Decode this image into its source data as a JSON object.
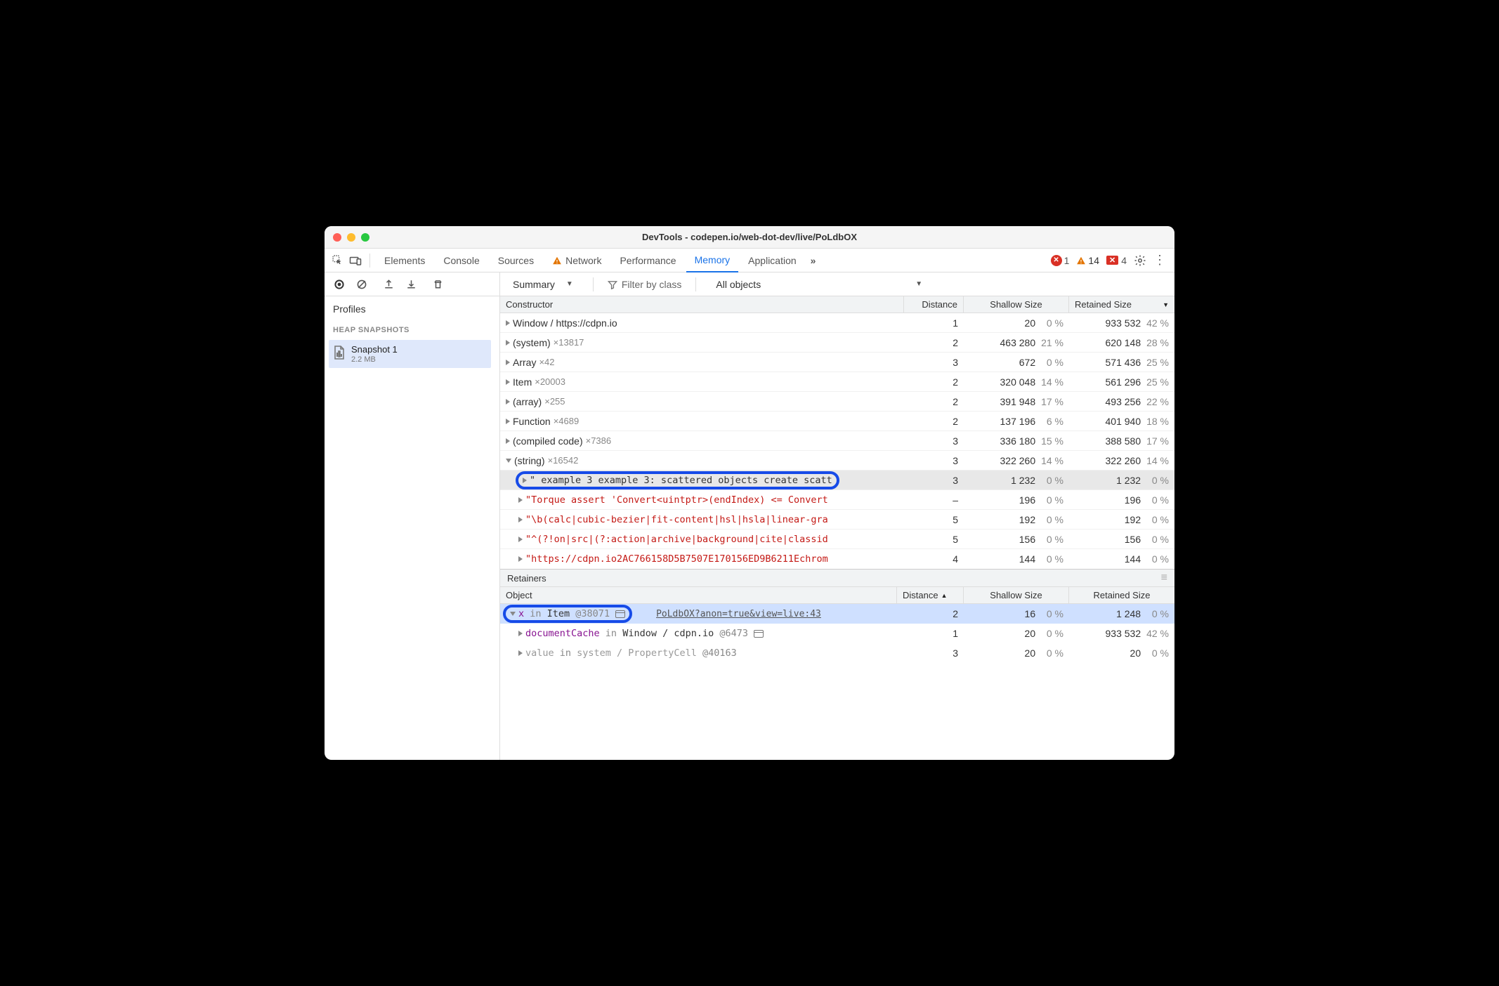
{
  "window_title": "DevTools - codepen.io/web-dot-dev/live/PoLdbOX",
  "tabs": {
    "elements": "Elements",
    "console": "Console",
    "sources": "Sources",
    "network": "Network",
    "performance": "Performance",
    "memory": "Memory",
    "application": "Application"
  },
  "status": {
    "errors": "1",
    "warnings": "14",
    "issues": "4"
  },
  "toolbar": {
    "summary": "Summary",
    "filter_placeholder": "Filter by class",
    "all_objects": "All objects"
  },
  "profiles": {
    "title": "Profiles",
    "section": "HEAP SNAPSHOTS",
    "snapshot_name": "Snapshot 1",
    "snapshot_size": "2.2 MB"
  },
  "columns": {
    "constructor": "Constructor",
    "distance": "Distance",
    "shallow": "Shallow Size",
    "retained": "Retained Size"
  },
  "rows": [
    {
      "name": "Window / https://cdpn.io",
      "count": "",
      "dist": "1",
      "ssize": "20",
      "spct": "0 %",
      "rsize": "933 532",
      "rpct": "42 %",
      "indent": 0
    },
    {
      "name": "(system)",
      "count": "×13817",
      "dist": "2",
      "ssize": "463 280",
      "spct": "21 %",
      "rsize": "620 148",
      "rpct": "28 %",
      "indent": 0
    },
    {
      "name": "Array",
      "count": "×42",
      "dist": "3",
      "ssize": "672",
      "spct": "0 %",
      "rsize": "571 436",
      "rpct": "25 %",
      "indent": 0
    },
    {
      "name": "Item",
      "count": "×20003",
      "dist": "2",
      "ssize": "320 048",
      "spct": "14 %",
      "rsize": "561 296",
      "rpct": "25 %",
      "indent": 0
    },
    {
      "name": "(array)",
      "count": "×255",
      "dist": "2",
      "ssize": "391 948",
      "spct": "17 %",
      "rsize": "493 256",
      "rpct": "22 %",
      "indent": 0
    },
    {
      "name": "Function",
      "count": "×4689",
      "dist": "2",
      "ssize": "137 196",
      "spct": "6 %",
      "rsize": "401 940",
      "rpct": "18 %",
      "indent": 0
    },
    {
      "name": "(compiled code)",
      "count": "×7386",
      "dist": "3",
      "ssize": "336 180",
      "spct": "15 %",
      "rsize": "388 580",
      "rpct": "17 %",
      "indent": 0
    },
    {
      "name": "(string)",
      "count": "×16542",
      "dist": "3",
      "ssize": "322 260",
      "spct": "14 %",
      "rsize": "322 260",
      "rpct": "14 %",
      "indent": 0,
      "open": true
    },
    {
      "name": "\"  example 3 example 3: scattered objects create scatt",
      "count": "",
      "dist": "3",
      "ssize": "1 232",
      "spct": "0 %",
      "rsize": "1 232",
      "rpct": "0 %",
      "indent": 1,
      "mono": true,
      "sel": true,
      "ring": true
    },
    {
      "name": "\"Torque assert 'Convert<uintptr>(endIndex) <= Convert",
      "count": "",
      "dist": "–",
      "ssize": "196",
      "spct": "0 %",
      "rsize": "196",
      "rpct": "0 %",
      "indent": 1,
      "mono": true,
      "str": true
    },
    {
      "name": "\"\\b(calc|cubic-bezier|fit-content|hsl|hsla|linear-gra",
      "count": "",
      "dist": "5",
      "ssize": "192",
      "spct": "0 %",
      "rsize": "192",
      "rpct": "0 %",
      "indent": 1,
      "mono": true,
      "str": true
    },
    {
      "name": "\"^(?!on|src|(?:action|archive|background|cite|classid",
      "count": "",
      "dist": "5",
      "ssize": "156",
      "spct": "0 %",
      "rsize": "156",
      "rpct": "0 %",
      "indent": 1,
      "mono": true,
      "str": true
    },
    {
      "name": "\"https://cdpn.io2AC766158D5B7507E170156ED9B6211Echrom",
      "count": "",
      "dist": "4",
      "ssize": "144",
      "spct": "0 %",
      "rsize": "144",
      "rpct": "0 %",
      "indent": 1,
      "mono": true,
      "str": true
    }
  ],
  "retainers": {
    "title": "Retainers",
    "cols": {
      "object": "Object",
      "distance": "Distance",
      "shallow": "Shallow Size",
      "retained": "Retained Size"
    },
    "rows": [
      {
        "open": true,
        "ring": true,
        "sel": true,
        "parts": {
          "prop": "x",
          "in": " in ",
          "ctx": "Item",
          "atid": " @38071"
        },
        "wicon": true,
        "link": "PoLdbOX?anon=true&view=live:43",
        "dist": "2",
        "ssize": "16",
        "spct": "0 %",
        "rsize": "1 248",
        "rpct": "0 %"
      },
      {
        "open": false,
        "indent": 1,
        "parts": {
          "prop": "documentCache",
          "in": " in ",
          "ctx": "Window / cdpn.io",
          "atid": " @6473"
        },
        "wicon": true,
        "dist": "1",
        "ssize": "20",
        "spct": "0 %",
        "rsize": "933 532",
        "rpct": "42 %"
      },
      {
        "open": false,
        "indent": 1,
        "dim": true,
        "parts": {
          "prop": "value",
          "in": " in ",
          "ctx": "system / PropertyCell",
          "atid": " @40163"
        },
        "dist": "3",
        "ssize": "20",
        "spct": "0 %",
        "rsize": "20",
        "rpct": "0 %"
      }
    ]
  }
}
